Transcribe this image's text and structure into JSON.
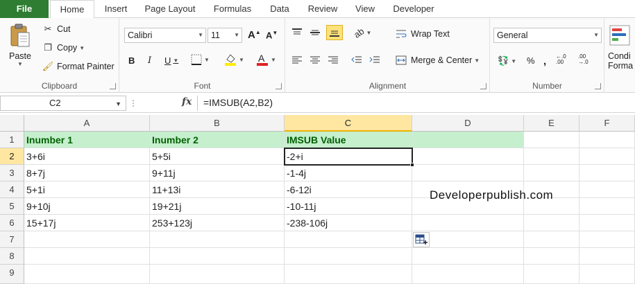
{
  "ribbon_tabs": [
    "File",
    "Home",
    "Insert",
    "Page Layout",
    "Formulas",
    "Data",
    "Review",
    "View",
    "Developer"
  ],
  "clipboard": {
    "paste": "Paste",
    "cut": "Cut",
    "copy": "Copy",
    "format_painter": "Format Painter",
    "label": "Clipboard"
  },
  "font": {
    "name": "Calibri",
    "size": "11",
    "label": "Font"
  },
  "alignment": {
    "wrap_text": "Wrap Text",
    "merge_center": "Merge & Center",
    "label": "Alignment"
  },
  "number": {
    "format": "General",
    "label": "Number"
  },
  "conditional": {
    "line1": "Condi",
    "line2": "Forma"
  },
  "formula_bar": {
    "name_box": "C2",
    "formula": "=IMSUB(A2,B2)"
  },
  "columns": [
    "A",
    "B",
    "C",
    "D",
    "E",
    "F"
  ],
  "rows": [
    "1",
    "2",
    "3",
    "4",
    "5",
    "6",
    "7",
    "8",
    "9"
  ],
  "table": {
    "headers": [
      "Inumber 1",
      "Inumber 2",
      "IMSUB Value"
    ],
    "rows": [
      [
        "3+6i",
        "5+5i",
        "-2+i"
      ],
      [
        "8+7j",
        "9+11j",
        "-1-4j"
      ],
      [
        "5+1i",
        "11+13i",
        "-6-12i"
      ],
      [
        "9+10j",
        "19+21j",
        "-10-11j"
      ],
      [
        "15+17j",
        "253+123j",
        "-238-106j"
      ]
    ]
  },
  "watermark": "Developerpublish.com",
  "colors": {
    "file_tab": "#2e7d32",
    "header_fill": "#c6efce",
    "header_text": "#006100",
    "selected_header": "#ffe7a2"
  }
}
